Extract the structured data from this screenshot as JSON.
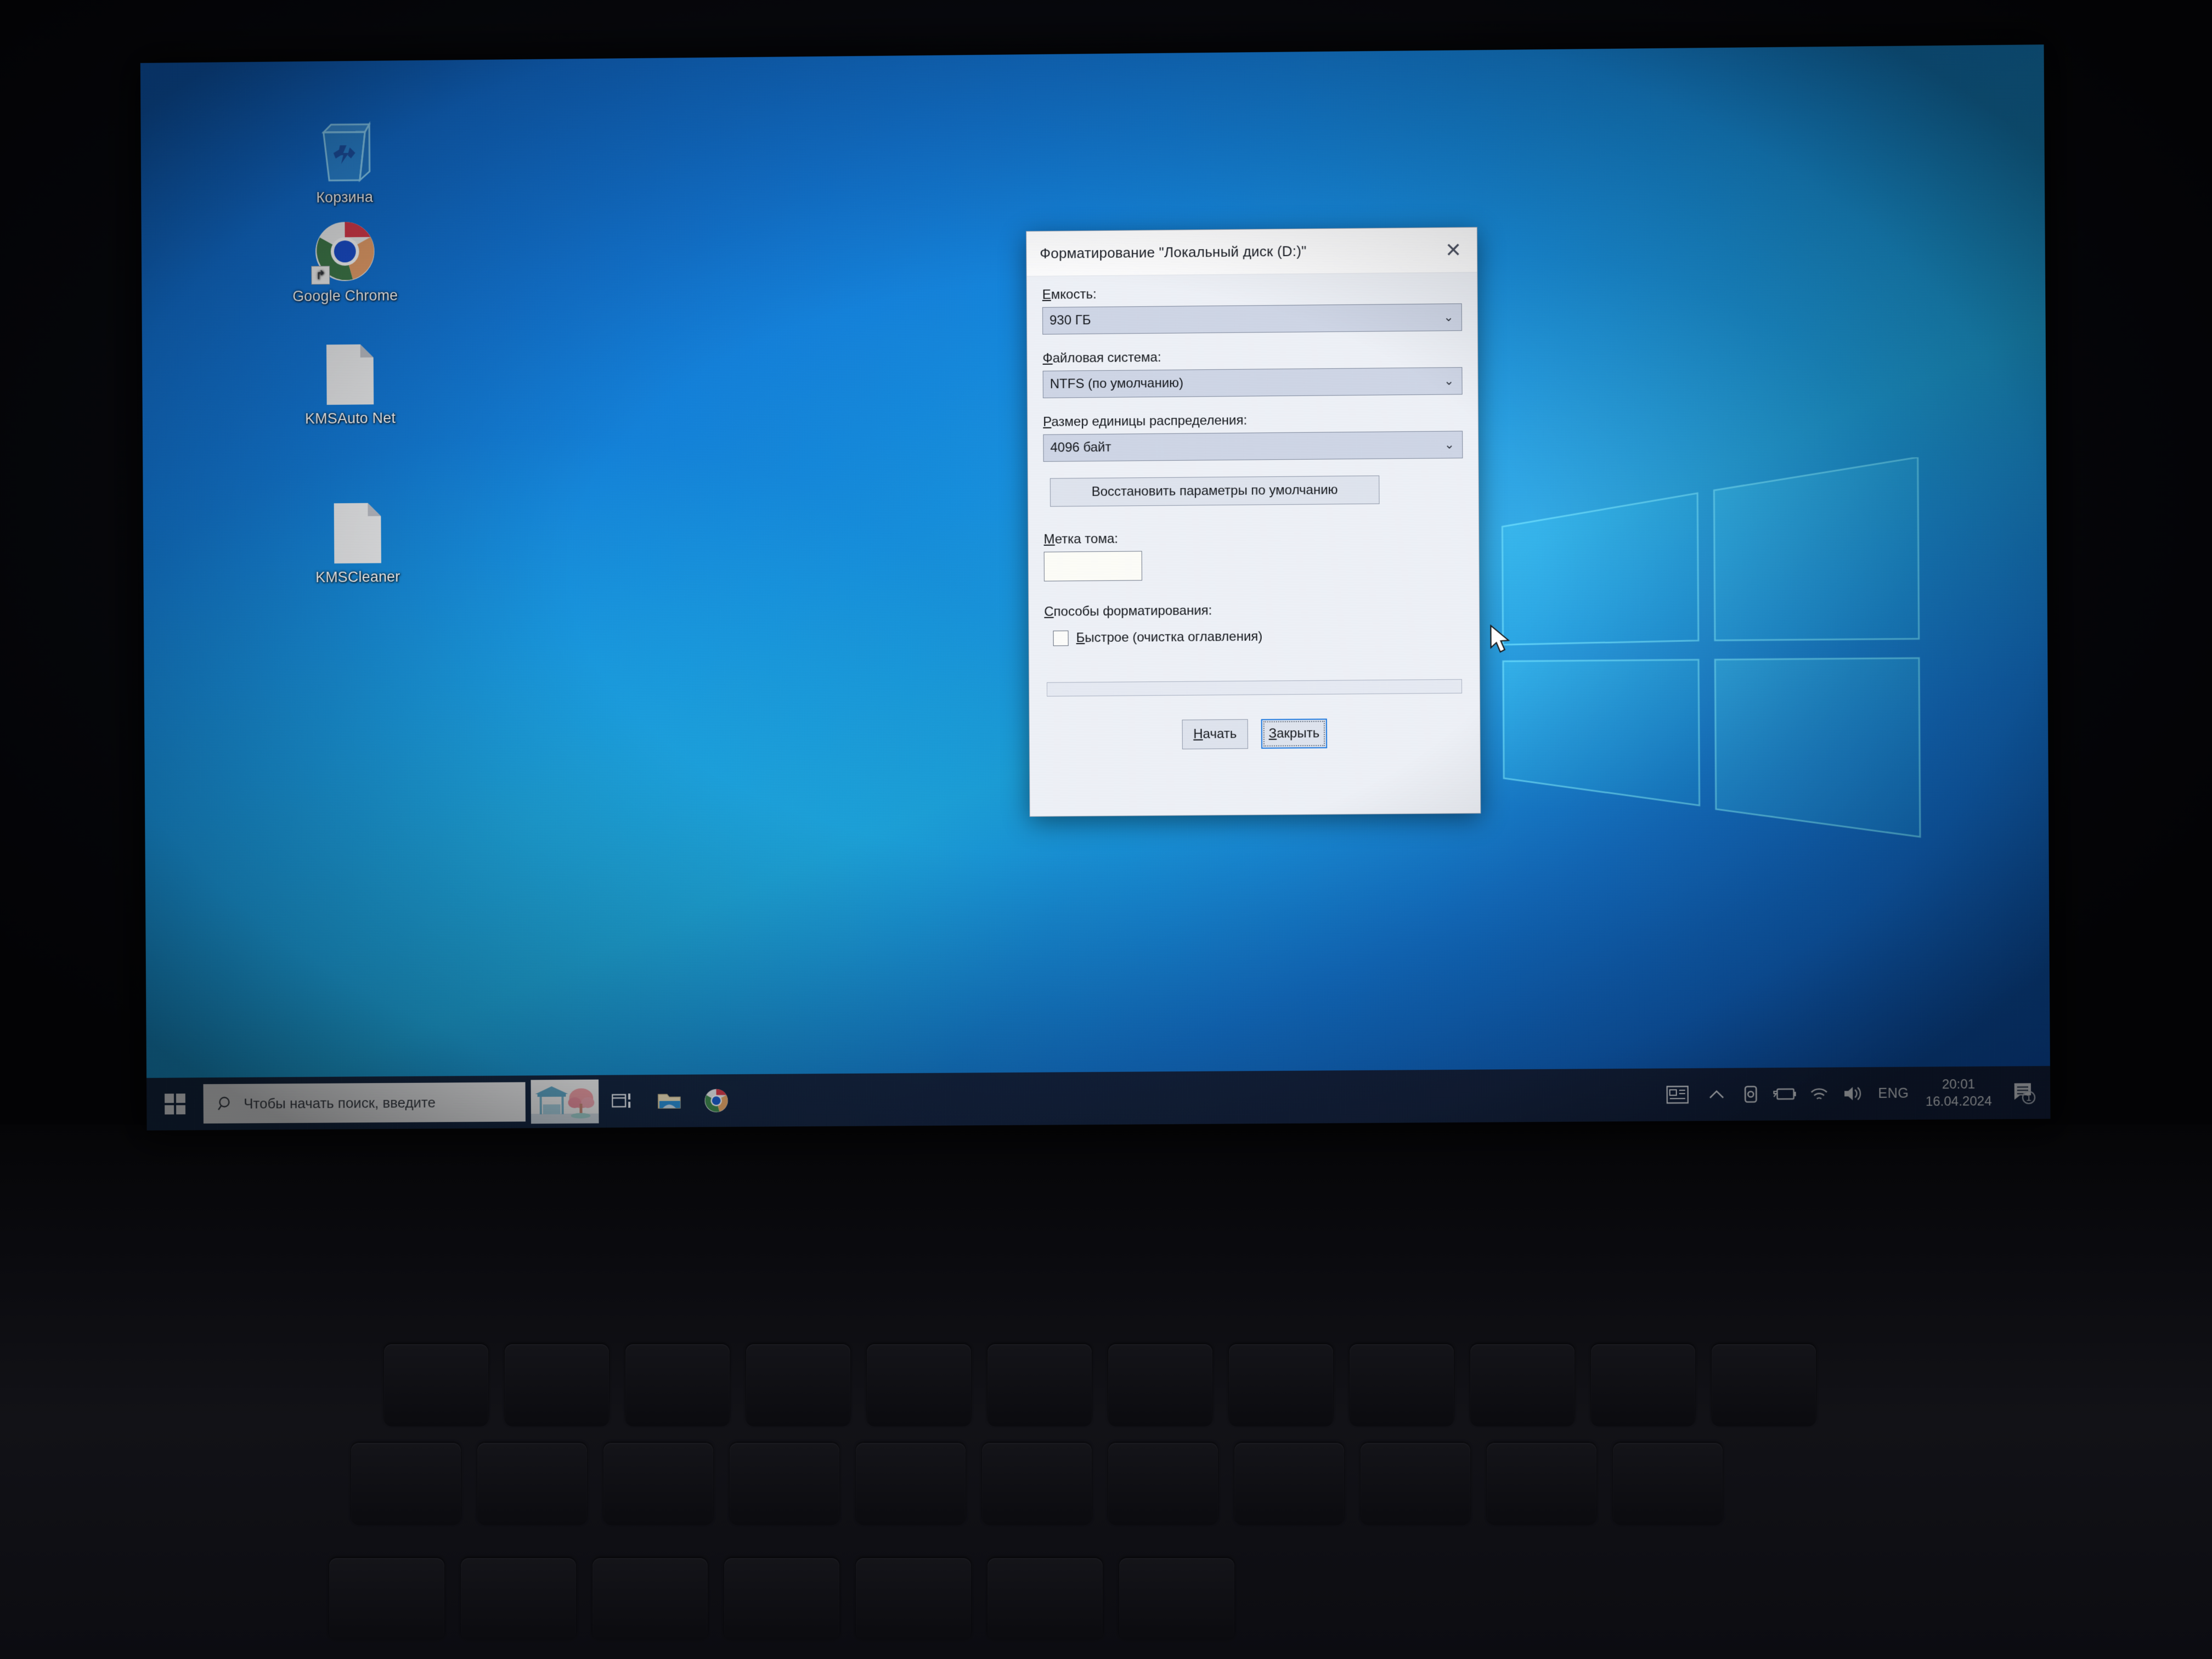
{
  "desktop": {
    "icons": [
      {
        "label": "Корзина",
        "icon": "recycle-bin-icon",
        "name": "recycle-bin"
      },
      {
        "label": "Google Chrome",
        "icon": "chrome-icon",
        "name": "google-chrome"
      },
      {
        "label": "KMSAuto Net",
        "icon": "file-icon",
        "name": "kmsauto-net"
      },
      {
        "label": "KMSCleaner",
        "icon": "file-icon",
        "name": "kmscleaner"
      }
    ]
  },
  "dialog": {
    "title": "Форматирование \"Локальный диск (D:)\"",
    "close_icon": "✕",
    "capacity": {
      "label": "Емкость:",
      "label_accel": "Е",
      "label_rest": "мкость:",
      "value": "930 ГБ"
    },
    "filesystem": {
      "label": "Файловая система:",
      "label_accel": "Ф",
      "label_rest": "айловая система:",
      "value": "NTFS (по умолчанию)"
    },
    "allocation": {
      "label": "Размер единицы распределения:",
      "label_accel": "Р",
      "label_rest": "азмер единицы распределения:",
      "value": "4096 байт"
    },
    "restore_defaults_label": "Восстановить параметры по умолчанию",
    "volume_label": {
      "label": "Метка тома:",
      "label_accel": "М",
      "label_rest": "етка тома:",
      "value": "",
      "placeholder": ""
    },
    "methods": {
      "label": "Способы форматирования:",
      "label_accel": "С",
      "label_rest": "пособы форматирования:"
    },
    "quick_format": {
      "label": "Быстрое (очистка оглавления)",
      "label_accel": "Б",
      "label_rest": "ыстрое (очистка оглавления)",
      "checked": false
    },
    "progress_percent": 0,
    "start_button": {
      "label": "Начать",
      "accel": "Н",
      "rest": "ачать"
    },
    "close_button": {
      "label": "Закрыть",
      "accel": "З",
      "rest": "акрыть",
      "focused": true
    },
    "caret_icon": "⌄"
  },
  "taskbar": {
    "start_icon": "windows-logo-icon",
    "search": {
      "placeholder": "Чтобы начать поиск, введите",
      "value": "",
      "icon": "search-icon"
    },
    "weather_tile": "weather-photo-tile",
    "task_view_icon": "task-view-icon",
    "file_explorer_icon": "file-explorer-icon",
    "chrome_icon": "chrome-icon",
    "tray": {
      "news_icon": "news-and-interests-icon",
      "overflow_icon": "chevron-up-icon",
      "onedrive_icon": "onedrive-icon",
      "battery_icon": "battery-charging-icon",
      "wifi_icon": "wifi-icon",
      "volume_icon": "volume-icon",
      "language": "ENG",
      "time": "20:01",
      "date": "16.04.2024",
      "notification_icon": "action-center-icon",
      "notification_count": "1"
    }
  },
  "colors": {
    "accent": "#1f7ae0",
    "wallpaper_blue": "#1278d8",
    "taskbar": "#141e37",
    "dialog_bg": "#eef1f7"
  }
}
